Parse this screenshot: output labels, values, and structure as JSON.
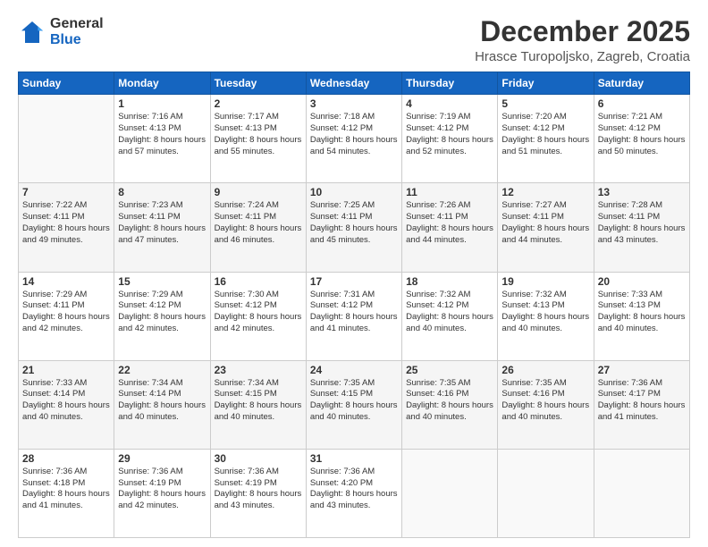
{
  "logo": {
    "line1": "General",
    "line2": "Blue"
  },
  "title": "December 2025",
  "location": "Hrasce Turopoljsko, Zagreb, Croatia",
  "weekdays": [
    "Sunday",
    "Monday",
    "Tuesday",
    "Wednesday",
    "Thursday",
    "Friday",
    "Saturday"
  ],
  "weeks": [
    [
      {
        "day": "",
        "sunrise": "",
        "sunset": "",
        "daylight": ""
      },
      {
        "day": "1",
        "sunrise": "Sunrise: 7:16 AM",
        "sunset": "Sunset: 4:13 PM",
        "daylight": "Daylight: 8 hours and 57 minutes."
      },
      {
        "day": "2",
        "sunrise": "Sunrise: 7:17 AM",
        "sunset": "Sunset: 4:13 PM",
        "daylight": "Daylight: 8 hours and 55 minutes."
      },
      {
        "day": "3",
        "sunrise": "Sunrise: 7:18 AM",
        "sunset": "Sunset: 4:12 PM",
        "daylight": "Daylight: 8 hours and 54 minutes."
      },
      {
        "day": "4",
        "sunrise": "Sunrise: 7:19 AM",
        "sunset": "Sunset: 4:12 PM",
        "daylight": "Daylight: 8 hours and 52 minutes."
      },
      {
        "day": "5",
        "sunrise": "Sunrise: 7:20 AM",
        "sunset": "Sunset: 4:12 PM",
        "daylight": "Daylight: 8 hours and 51 minutes."
      },
      {
        "day": "6",
        "sunrise": "Sunrise: 7:21 AM",
        "sunset": "Sunset: 4:12 PM",
        "daylight": "Daylight: 8 hours and 50 minutes."
      }
    ],
    [
      {
        "day": "7",
        "sunrise": "Sunrise: 7:22 AM",
        "sunset": "Sunset: 4:11 PM",
        "daylight": "Daylight: 8 hours and 49 minutes."
      },
      {
        "day": "8",
        "sunrise": "Sunrise: 7:23 AM",
        "sunset": "Sunset: 4:11 PM",
        "daylight": "Daylight: 8 hours and 47 minutes."
      },
      {
        "day": "9",
        "sunrise": "Sunrise: 7:24 AM",
        "sunset": "Sunset: 4:11 PM",
        "daylight": "Daylight: 8 hours and 46 minutes."
      },
      {
        "day": "10",
        "sunrise": "Sunrise: 7:25 AM",
        "sunset": "Sunset: 4:11 PM",
        "daylight": "Daylight: 8 hours and 45 minutes."
      },
      {
        "day": "11",
        "sunrise": "Sunrise: 7:26 AM",
        "sunset": "Sunset: 4:11 PM",
        "daylight": "Daylight: 8 hours and 44 minutes."
      },
      {
        "day": "12",
        "sunrise": "Sunrise: 7:27 AM",
        "sunset": "Sunset: 4:11 PM",
        "daylight": "Daylight: 8 hours and 44 minutes."
      },
      {
        "day": "13",
        "sunrise": "Sunrise: 7:28 AM",
        "sunset": "Sunset: 4:11 PM",
        "daylight": "Daylight: 8 hours and 43 minutes."
      }
    ],
    [
      {
        "day": "14",
        "sunrise": "Sunrise: 7:29 AM",
        "sunset": "Sunset: 4:11 PM",
        "daylight": "Daylight: 8 hours and 42 minutes."
      },
      {
        "day": "15",
        "sunrise": "Sunrise: 7:29 AM",
        "sunset": "Sunset: 4:12 PM",
        "daylight": "Daylight: 8 hours and 42 minutes."
      },
      {
        "day": "16",
        "sunrise": "Sunrise: 7:30 AM",
        "sunset": "Sunset: 4:12 PM",
        "daylight": "Daylight: 8 hours and 42 minutes."
      },
      {
        "day": "17",
        "sunrise": "Sunrise: 7:31 AM",
        "sunset": "Sunset: 4:12 PM",
        "daylight": "Daylight: 8 hours and 41 minutes."
      },
      {
        "day": "18",
        "sunrise": "Sunrise: 7:32 AM",
        "sunset": "Sunset: 4:12 PM",
        "daylight": "Daylight: 8 hours and 40 minutes."
      },
      {
        "day": "19",
        "sunrise": "Sunrise: 7:32 AM",
        "sunset": "Sunset: 4:13 PM",
        "daylight": "Daylight: 8 hours and 40 minutes."
      },
      {
        "day": "20",
        "sunrise": "Sunrise: 7:33 AM",
        "sunset": "Sunset: 4:13 PM",
        "daylight": "Daylight: 8 hours and 40 minutes."
      }
    ],
    [
      {
        "day": "21",
        "sunrise": "Sunrise: 7:33 AM",
        "sunset": "Sunset: 4:14 PM",
        "daylight": "Daylight: 8 hours and 40 minutes."
      },
      {
        "day": "22",
        "sunrise": "Sunrise: 7:34 AM",
        "sunset": "Sunset: 4:14 PM",
        "daylight": "Daylight: 8 hours and 40 minutes."
      },
      {
        "day": "23",
        "sunrise": "Sunrise: 7:34 AM",
        "sunset": "Sunset: 4:15 PM",
        "daylight": "Daylight: 8 hours and 40 minutes."
      },
      {
        "day": "24",
        "sunrise": "Sunrise: 7:35 AM",
        "sunset": "Sunset: 4:15 PM",
        "daylight": "Daylight: 8 hours and 40 minutes."
      },
      {
        "day": "25",
        "sunrise": "Sunrise: 7:35 AM",
        "sunset": "Sunset: 4:16 PM",
        "daylight": "Daylight: 8 hours and 40 minutes."
      },
      {
        "day": "26",
        "sunrise": "Sunrise: 7:35 AM",
        "sunset": "Sunset: 4:16 PM",
        "daylight": "Daylight: 8 hours and 40 minutes."
      },
      {
        "day": "27",
        "sunrise": "Sunrise: 7:36 AM",
        "sunset": "Sunset: 4:17 PM",
        "daylight": "Daylight: 8 hours and 41 minutes."
      }
    ],
    [
      {
        "day": "28",
        "sunrise": "Sunrise: 7:36 AM",
        "sunset": "Sunset: 4:18 PM",
        "daylight": "Daylight: 8 hours and 41 minutes."
      },
      {
        "day": "29",
        "sunrise": "Sunrise: 7:36 AM",
        "sunset": "Sunset: 4:19 PM",
        "daylight": "Daylight: 8 hours and 42 minutes."
      },
      {
        "day": "30",
        "sunrise": "Sunrise: 7:36 AM",
        "sunset": "Sunset: 4:19 PM",
        "daylight": "Daylight: 8 hours and 43 minutes."
      },
      {
        "day": "31",
        "sunrise": "Sunrise: 7:36 AM",
        "sunset": "Sunset: 4:20 PM",
        "daylight": "Daylight: 8 hours and 43 minutes."
      },
      {
        "day": "",
        "sunrise": "",
        "sunset": "",
        "daylight": ""
      },
      {
        "day": "",
        "sunrise": "",
        "sunset": "",
        "daylight": ""
      },
      {
        "day": "",
        "sunrise": "",
        "sunset": "",
        "daylight": ""
      }
    ]
  ]
}
